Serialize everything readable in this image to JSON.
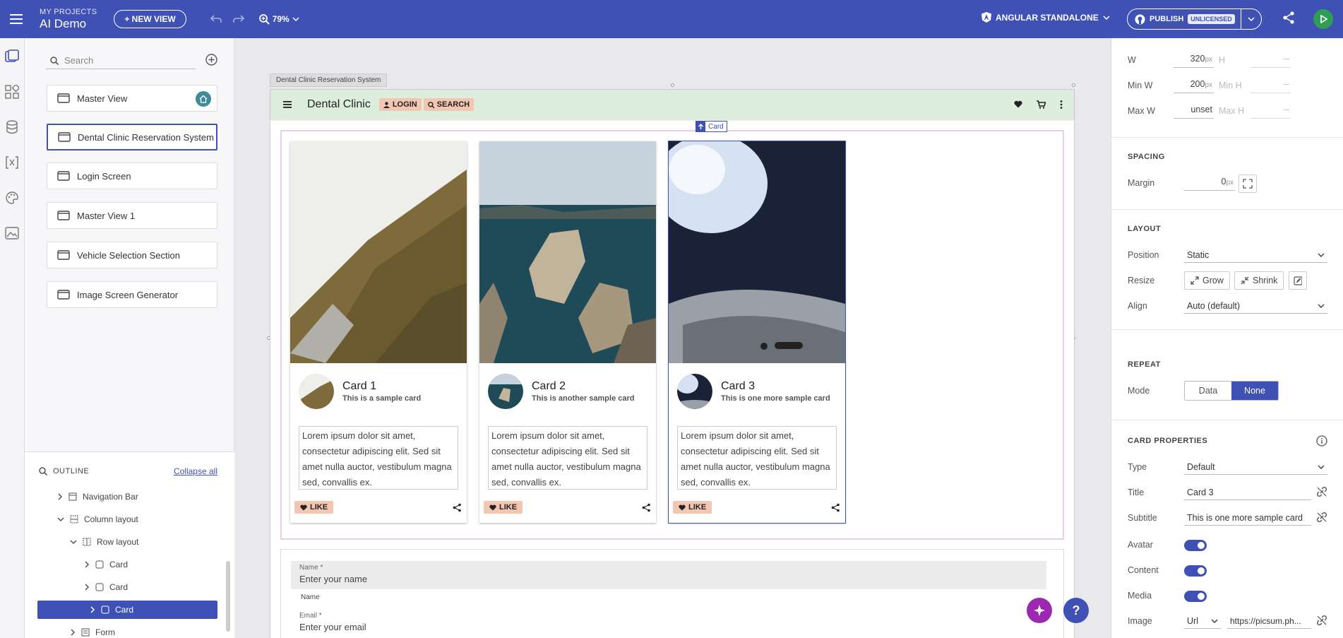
{
  "topbar": {
    "projects_label": "MY PROJECTS",
    "project_name": "AI Demo",
    "new_view": "+ NEW VIEW",
    "zoom": "79%",
    "framework": "ANGULAR STANDALONE",
    "publish": "PUBLISH",
    "license": "UNLICENSED"
  },
  "left": {
    "search_placeholder": "Search",
    "views": [
      "Master View",
      "Dental Clinic Reservation System",
      "Login Screen",
      "Master View 1",
      "Vehicle Selection Section",
      "Image Screen Generator"
    ],
    "outline_title": "OUTLINE",
    "collapse_all": "Collapse all",
    "tree": [
      "Navigation Bar",
      "Column layout",
      "Row layout",
      "Card",
      "Card",
      "Card",
      "Form"
    ]
  },
  "canvas": {
    "frame_label": "Dental Clinic Reservation System",
    "app_title": "Dental Clinic",
    "login": "LOGIN",
    "search": "SEARCH",
    "card_tag": "Card",
    "cards": [
      {
        "title": "Card 1",
        "subtitle": "This is a sample card",
        "body": "Lorem ipsum dolor sit amet, consectetur adipiscing elit. Sed sit amet nulla auctor, vestibulum magna sed, convallis ex.",
        "like": "LIKE"
      },
      {
        "title": "Card 2",
        "subtitle": "This is another sample card",
        "body": "Lorem ipsum dolor sit amet, consectetur adipiscing elit. Sed sit amet nulla auctor, vestibulum magna sed, convallis ex.",
        "like": "LIKE"
      },
      {
        "title": "Card 3",
        "subtitle": "This is one more sample card",
        "body": "Lorem ipsum dolor sit amet, consectetur adipiscing elit. Sed sit amet nulla auctor, vestibulum magna sed, convallis ex.",
        "like": "LIKE"
      }
    ],
    "form": {
      "name_label": "Name *",
      "name_placeholder": "Enter your name",
      "name_helper": "Name",
      "email_label": "Email *",
      "email_placeholder": "Enter your email"
    },
    "help": "?"
  },
  "right": {
    "w_label": "W",
    "w_value": "320",
    "h_label": "H",
    "h_value": "--",
    "minw_label": "Min W",
    "minw_value": "200",
    "minh_label": "Min H",
    "minh_value": "--",
    "maxw_label": "Max W",
    "maxw_value": "unset",
    "maxh_label": "Max H",
    "maxh_value": "--",
    "px": "px",
    "spacing": "SPACING",
    "margin_label": "Margin",
    "margin_value": "0",
    "layout": "LAYOUT",
    "position_label": "Position",
    "position_value": "Static",
    "resize_label": "Resize",
    "grow": "Grow",
    "shrink": "Shrink",
    "align_label": "Align",
    "align_value": "Auto (default)",
    "repeat": "REPEAT",
    "mode_label": "Mode",
    "mode_data": "Data",
    "mode_none": "None",
    "card_props": "CARD PROPERTIES",
    "type_label": "Type",
    "type_value": "Default",
    "title_label": "Title",
    "title_value": "Card 3",
    "subtitle_label": "Subtitle",
    "subtitle_value": "This is one more sample card",
    "avatar_label": "Avatar",
    "content_label": "Content",
    "media_label": "Media",
    "image_label": "Image",
    "image_type": "Url",
    "image_value": "https://picsum.ph..."
  }
}
